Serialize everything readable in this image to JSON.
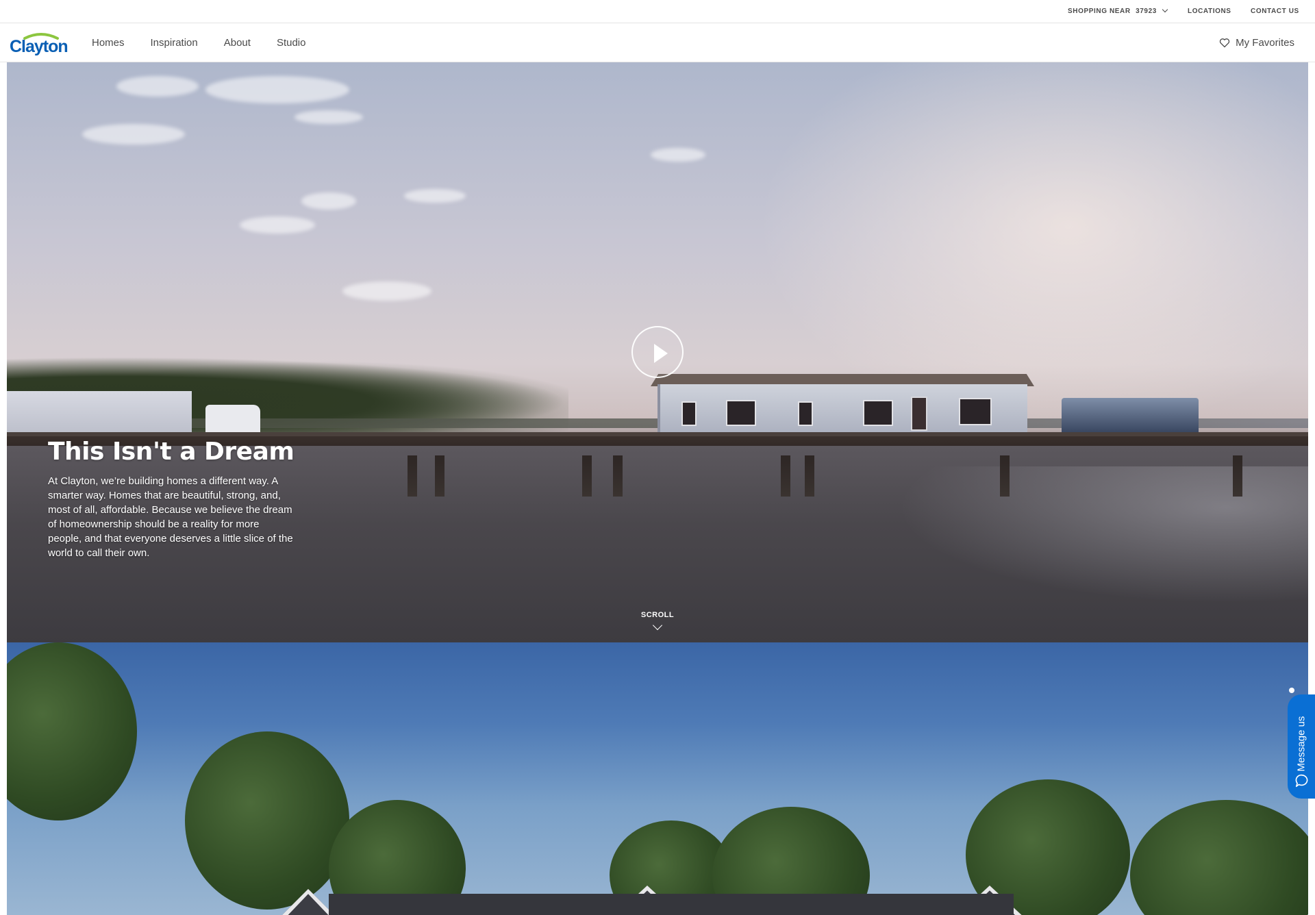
{
  "utility_bar": {
    "shopping_near_label": "SHOPPING NEAR",
    "zip": "37923",
    "locations_label": "LOCATIONS",
    "contact_label": "CONTACT US"
  },
  "nav": {
    "logo_text": "Clayton",
    "links": [
      "Homes",
      "Inspiration",
      "About",
      "Studio"
    ],
    "favorites_label": "My Favorites"
  },
  "hero": {
    "title": "This Isn't a Dream",
    "body": "At Clayton, we’re building homes a different way. A smarter way. Homes that are beautiful, strong, and, most of all, affordable. Because we believe the dream of homeownership should be a reality for more people, and that everyone deserves a little slice of the world to call their own.",
    "scroll_label": "SCROLL"
  },
  "message_tab": {
    "label": "Message us"
  },
  "section_dots": {
    "count": 8,
    "active_index": 0
  },
  "colors": {
    "brand_blue": "#0a5fb4",
    "message_blue": "#0a6fd4",
    "nav_text": "#4a4a4a",
    "logo_arc_green": "#8cc63f"
  },
  "icons": [
    "chevron-down-icon",
    "heart-icon",
    "play-icon",
    "scroll-chevron-icon",
    "chat-icon",
    "clayton-logo"
  ]
}
